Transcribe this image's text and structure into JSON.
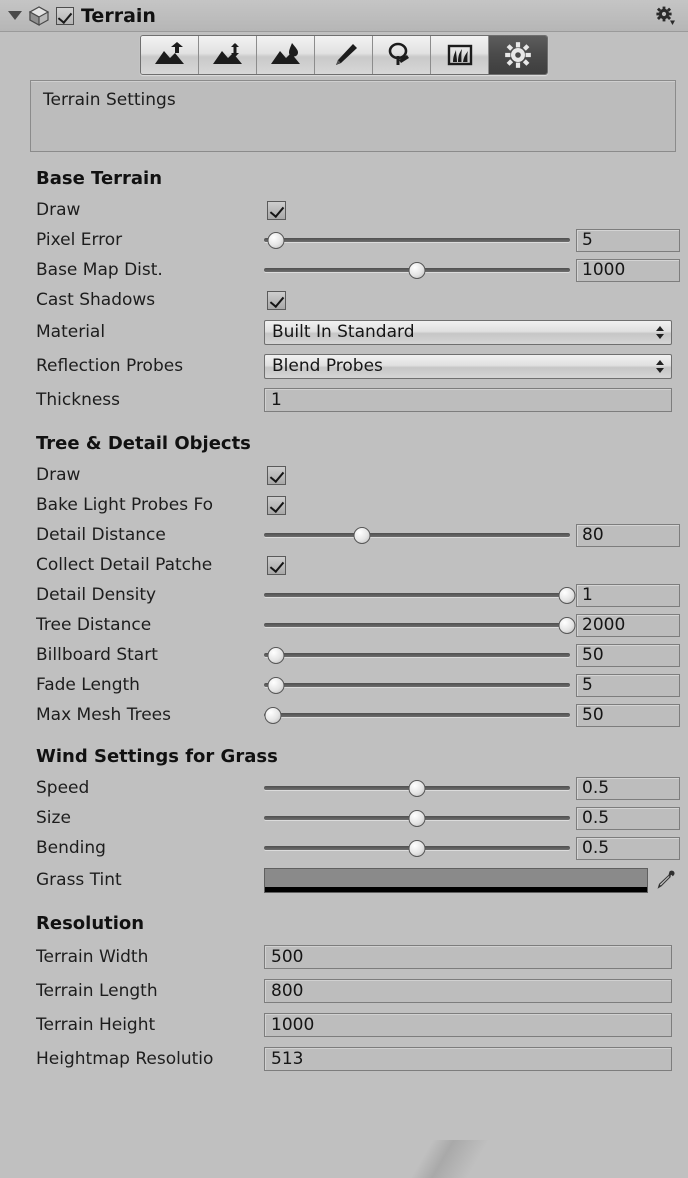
{
  "header": {
    "foldout_icon": "triangle-down-icon",
    "component_icon": "terrain-icon",
    "enabled": true,
    "title": "Terrain",
    "settings_icon": "gear-icon"
  },
  "toolbar": {
    "buttons": [
      {
        "name": "raise-lower-terrain",
        "icon": "terrain-raise-icon",
        "selected": false
      },
      {
        "name": "set-height",
        "icon": "terrain-set-height-icon",
        "selected": false
      },
      {
        "name": "smooth-height",
        "icon": "terrain-smooth-icon",
        "selected": false
      },
      {
        "name": "paint-texture",
        "icon": "paintbrush-icon",
        "selected": false
      },
      {
        "name": "place-trees",
        "icon": "tree-icon",
        "selected": false
      },
      {
        "name": "paint-details",
        "icon": "grass-details-icon",
        "selected": false
      },
      {
        "name": "terrain-settings",
        "icon": "gear-icon",
        "selected": true
      }
    ]
  },
  "helpbox": {
    "text": "Terrain Settings"
  },
  "sections": {
    "base_terrain": {
      "title": "Base Terrain",
      "rows": [
        {
          "label": "Draw",
          "type": "checkbox",
          "value": true
        },
        {
          "label": "Pixel Error",
          "type": "slider",
          "value": "5",
          "fill": 4
        },
        {
          "label": "Base Map Dist.",
          "type": "slider",
          "value": "1000",
          "fill": 50
        },
        {
          "label": "Cast Shadows",
          "type": "checkbox",
          "value": true
        },
        {
          "label": "Material",
          "type": "dropdown",
          "value": "Built In Standard"
        },
        {
          "label": "Reflection Probes",
          "type": "dropdown",
          "value": "Blend Probes"
        },
        {
          "label": "Thickness",
          "type": "text",
          "value": "1"
        }
      ]
    },
    "tree_detail": {
      "title": "Tree & Detail Objects",
      "rows": [
        {
          "label": "Draw",
          "type": "checkbox",
          "value": true
        },
        {
          "label": "Bake Light Probes Fo",
          "type": "checkbox",
          "value": true
        },
        {
          "label": "Detail Distance",
          "type": "slider",
          "value": "80",
          "fill": 32
        },
        {
          "label": "Collect Detail Patche",
          "type": "checkbox",
          "value": true
        },
        {
          "label": "Detail Density",
          "type": "slider",
          "value": "1",
          "fill": 100
        },
        {
          "label": "Tree Distance",
          "type": "slider",
          "value": "2000",
          "fill": 100
        },
        {
          "label": "Billboard Start",
          "type": "slider",
          "value": "50",
          "fill": 4
        },
        {
          "label": "Fade Length",
          "type": "slider",
          "value": "5",
          "fill": 4
        },
        {
          "label": "Max Mesh Trees",
          "type": "slider",
          "value": "50",
          "fill": 3
        }
      ]
    },
    "wind": {
      "title": "Wind Settings for Grass",
      "rows": [
        {
          "label": "Speed",
          "type": "slider",
          "value": "0.5",
          "fill": 50
        },
        {
          "label": "Size",
          "type": "slider",
          "value": "0.5",
          "fill": 50
        },
        {
          "label": "Bending",
          "type": "slider",
          "value": "0.5",
          "fill": 50
        },
        {
          "label": "Grass Tint",
          "type": "color",
          "value": "#8a8a8a",
          "picker_icon": "eyedropper-icon"
        }
      ]
    },
    "resolution": {
      "title": "Resolution",
      "rows": [
        {
          "label": "Terrain Width",
          "type": "text",
          "value": "500"
        },
        {
          "label": "Terrain Length",
          "type": "text",
          "value": "800"
        },
        {
          "label": "Terrain Height",
          "type": "text",
          "value": "1000"
        },
        {
          "label": "Heightmap Resolutio",
          "type": "text",
          "value": "513"
        }
      ]
    }
  }
}
